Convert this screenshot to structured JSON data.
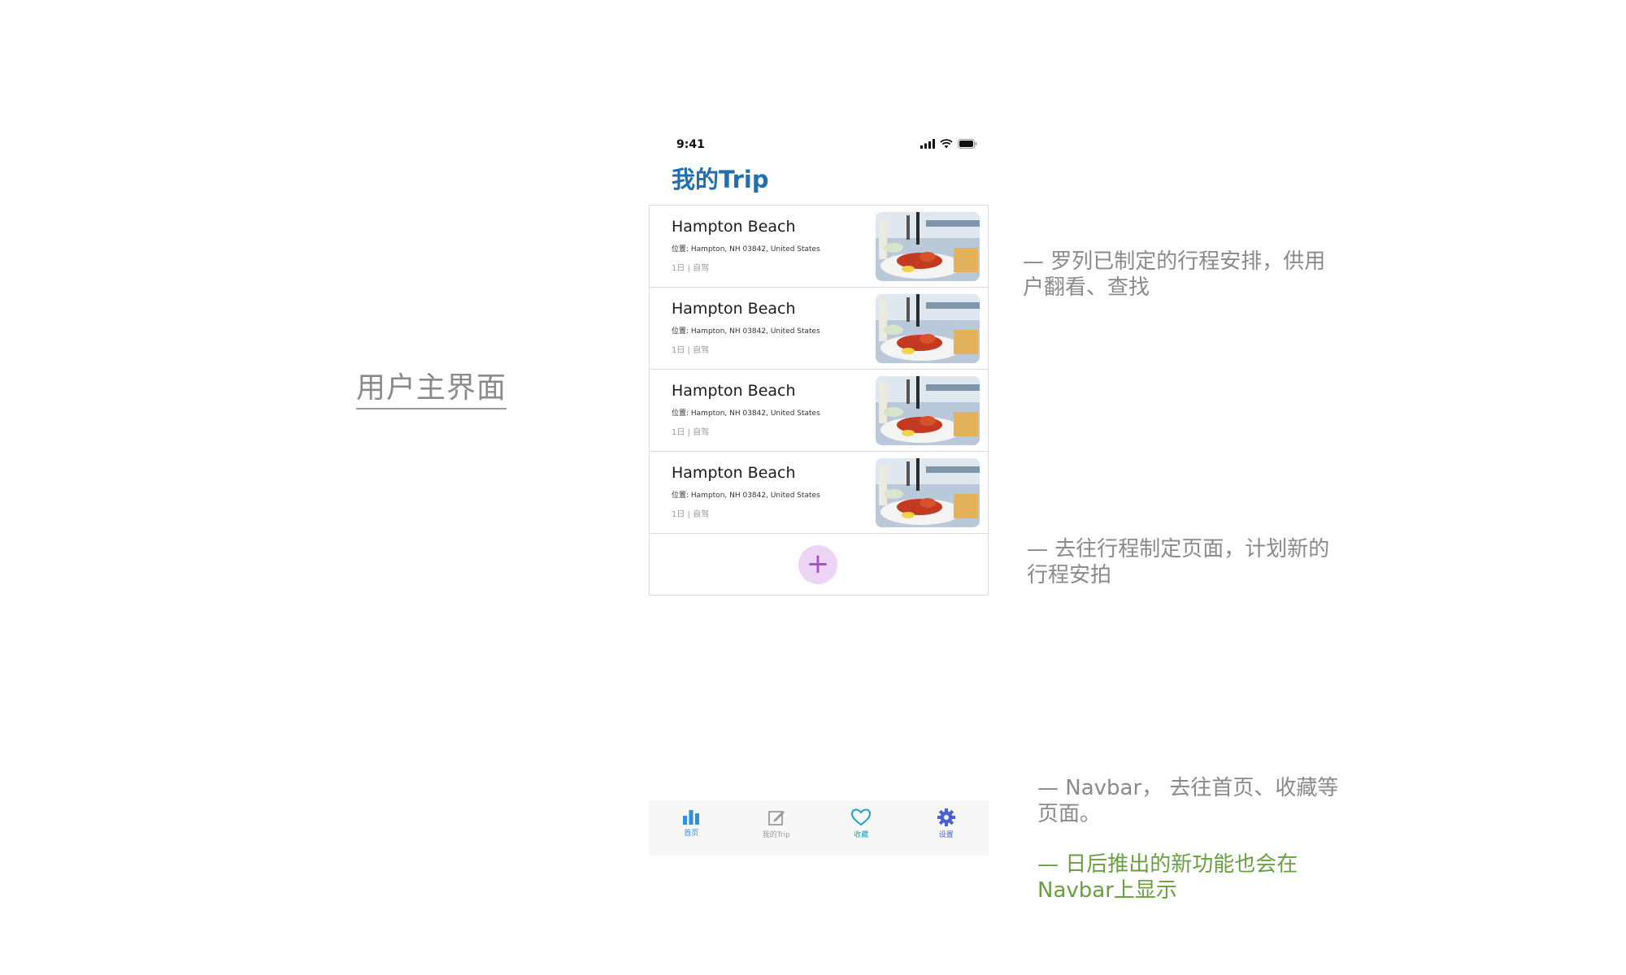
{
  "left_title": "用户主界面",
  "status_bar": {
    "time": "9:41"
  },
  "page_title": "我的Trip",
  "trips": [
    {
      "name": "Hampton Beach",
      "location": "位置: Hampton, NH 03842, United States",
      "meta": "1日 | 自驾"
    },
    {
      "name": "Hampton Beach",
      "location": "位置: Hampton, NH 03842, United States",
      "meta": "1日 | 自驾"
    },
    {
      "name": "Hampton Beach",
      "location": "位置: Hampton, NH 03842, United States",
      "meta": "1日 | 自驾"
    },
    {
      "name": "Hampton Beach",
      "location": "位置: Hampton, NH 03842, United States",
      "meta": "1日 | 自驾"
    }
  ],
  "add_button": {
    "label": "+"
  },
  "navbar": {
    "items": [
      {
        "label": "首页",
        "icon": "bar-chart-icon",
        "color": "#2f8fe0"
      },
      {
        "label": "我的Trip",
        "icon": "edit-icon",
        "color": "#9a9a9a"
      },
      {
        "label": "收藏",
        "icon": "heart-icon",
        "color": "#1aa3c8"
      },
      {
        "label": "设置",
        "icon": "gear-icon",
        "color": "#4a5fd8"
      }
    ]
  },
  "annotations": {
    "list": "— 罗列已制定的行程安排，供用户翻看、查找",
    "add": "— 去往行程制定页面，计划新的行程安拍",
    "navbar": "— Navbar， 去往首页、收藏等页面。",
    "future": "— 日后推出的新功能也会在Navbar上显示"
  },
  "colors": {
    "title_blue": "#1f6fb2",
    "add_bg": "#ecd4f5",
    "add_fg": "#a350c8",
    "note_grey": "#8a8a8a",
    "note_green": "#6a9f3e"
  }
}
